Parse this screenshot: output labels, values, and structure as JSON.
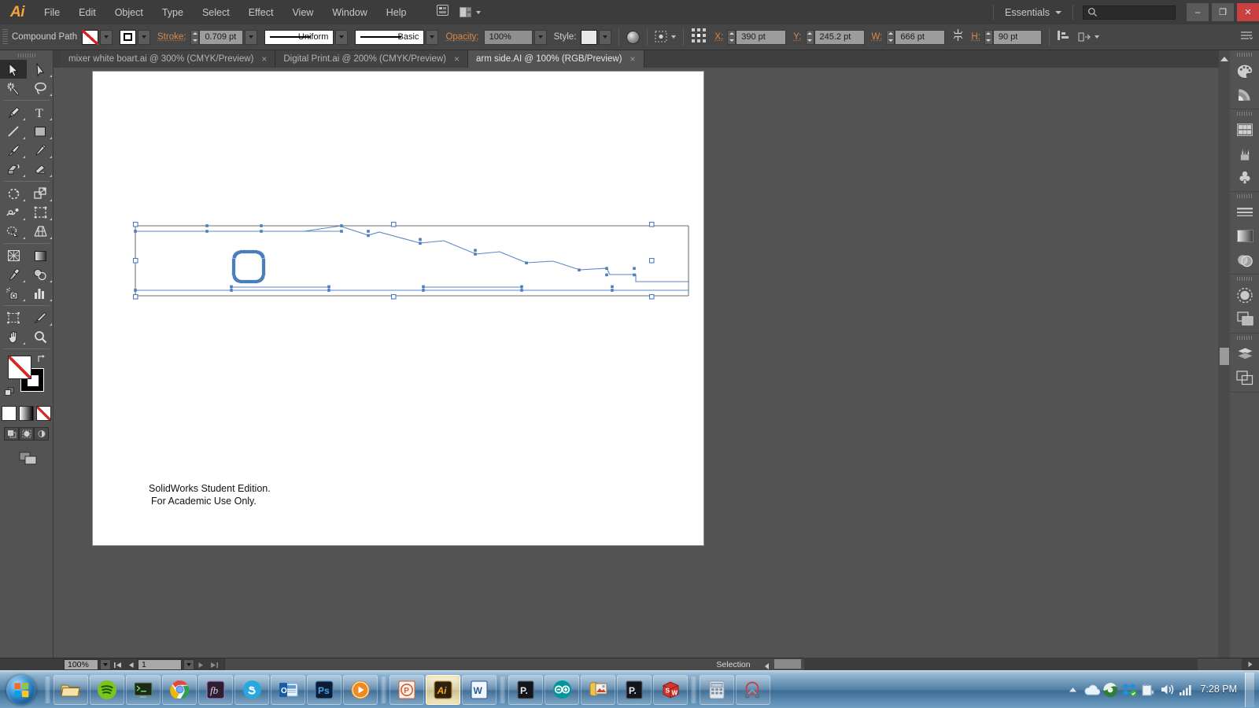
{
  "app": {
    "name": "Adobe Illustrator",
    "logo_text": "Ai"
  },
  "menubar": {
    "items": [
      {
        "label": "File"
      },
      {
        "label": "Edit"
      },
      {
        "label": "Object"
      },
      {
        "label": "Type"
      },
      {
        "label": "Select"
      },
      {
        "label": "Effect"
      },
      {
        "label": "View"
      },
      {
        "label": "Window"
      },
      {
        "label": "Help"
      }
    ],
    "workspace": "Essentials",
    "search_value": "",
    "search_placeholder": "",
    "window_controls": {
      "minimize": "–",
      "restore": "❐",
      "close": "✕"
    }
  },
  "controlbar": {
    "selection_type": "Compound Path",
    "fill_swatch": "none",
    "stroke_swatch": "black",
    "stroke_label": "Stroke:",
    "stroke_weight": "0.709 pt",
    "stroke_profile": "Uniform",
    "brush_definition": "Basic",
    "opacity_label": "Opacity:",
    "opacity_value": "100%",
    "style_label": "Style:",
    "x_label": "X:",
    "x_value": "390 pt",
    "y_label": "Y:",
    "y_value": "245.2 pt",
    "w_label": "W:",
    "w_value": "666 pt",
    "h_label": "H:",
    "h_value": "90 pt"
  },
  "tabs": [
    {
      "title": "mixer white boart.ai @ 300% (CMYK/Preview)",
      "close": "×",
      "active": false
    },
    {
      "title": "Digital Print.ai @ 200% (CMYK/Preview)",
      "close": "×",
      "active": false
    },
    {
      "title": "arm side.AI @ 100% (RGB/Preview)",
      "close": "×",
      "active": true
    }
  ],
  "toolbar": {
    "tools": [
      {
        "name": "selection-tool",
        "selected": true
      },
      {
        "name": "direct-selection-tool",
        "selected": false
      },
      {
        "name": "magic-wand-tool",
        "selected": false
      },
      {
        "name": "lasso-tool",
        "selected": false
      },
      {
        "name": "pen-tool",
        "selected": false
      },
      {
        "name": "type-tool",
        "selected": false
      },
      {
        "name": "line-segment-tool",
        "selected": false
      },
      {
        "name": "rectangle-tool",
        "selected": false
      },
      {
        "name": "paintbrush-tool",
        "selected": false
      },
      {
        "name": "pencil-tool",
        "selected": false
      },
      {
        "name": "blob-brush-tool",
        "selected": false
      },
      {
        "name": "eraser-tool",
        "selected": false
      },
      {
        "name": "rotate-tool",
        "selected": false
      },
      {
        "name": "scale-tool",
        "selected": false
      },
      {
        "name": "width-tool",
        "selected": false
      },
      {
        "name": "free-transform-tool",
        "selected": false
      },
      {
        "name": "shape-builder-tool",
        "selected": false
      },
      {
        "name": "perspective-grid-tool",
        "selected": false
      },
      {
        "name": "mesh-tool",
        "selected": false
      },
      {
        "name": "gradient-tool",
        "selected": false
      },
      {
        "name": "eyedropper-tool",
        "selected": false
      },
      {
        "name": "blend-tool",
        "selected": false
      },
      {
        "name": "symbol-sprayer-tool",
        "selected": false
      },
      {
        "name": "column-graph-tool",
        "selected": false
      },
      {
        "name": "artboard-tool",
        "selected": false
      },
      {
        "name": "slice-tool",
        "selected": false
      },
      {
        "name": "hand-tool",
        "selected": false
      },
      {
        "name": "zoom-tool",
        "selected": false
      }
    ],
    "fill_color": "#ffffff",
    "fill_is_none": true,
    "stroke_color": "#000000",
    "modes": [
      "color",
      "gradient",
      "none"
    ]
  },
  "right_dock": {
    "groups": [
      {
        "icons": [
          "color-panel-icon",
          "color-guide-icon"
        ]
      },
      {
        "icons": [
          "swatches-panel-icon",
          "brushes-panel-icon",
          "symbols-panel-icon"
        ]
      },
      {
        "icons": [
          "stroke-panel-icon",
          "gradient-panel-icon",
          "transparency-panel-icon"
        ]
      },
      {
        "icons": [
          "appearance-panel-icon",
          "graphic-styles-panel-icon"
        ]
      },
      {
        "icons": [
          "layers-panel-icon",
          "artboards-panel-icon"
        ]
      }
    ]
  },
  "artboard": {
    "text_line1": "SolidWorks Student Edition.",
    "text_line2": "For Academic Use Only."
  },
  "statusbar": {
    "zoom_value": "100%",
    "page_value": "1",
    "status_text": "Selection",
    "nav_first": "⏮",
    "nav_prev": "◀",
    "nav_next": "▶",
    "nav_last": "⏭"
  },
  "taskbar": {
    "start_label": "Start",
    "buttons": [
      {
        "name": "taskbar-windows-explorer",
        "label": "Windows Explorer"
      },
      {
        "name": "taskbar-spotify",
        "label": "Spotify"
      },
      {
        "name": "taskbar-terminal",
        "label": "Terminal"
      },
      {
        "name": "taskbar-google-chrome",
        "label": "Google Chrome"
      },
      {
        "name": "taskbar-fb-app",
        "label": "fb"
      },
      {
        "name": "taskbar-skype",
        "label": "Skype"
      },
      {
        "name": "taskbar-outlook",
        "label": "Microsoft Outlook"
      },
      {
        "name": "taskbar-photoshop",
        "label": "Adobe Photoshop"
      },
      {
        "name": "taskbar-vlc",
        "label": "VLC Media Player"
      },
      {
        "name": "taskbar-powerpoint-1",
        "label": "Microsoft PowerPoint"
      },
      {
        "name": "taskbar-illustrator",
        "label": "Adobe Illustrator",
        "active": true
      },
      {
        "name": "taskbar-word",
        "label": "Microsoft Word"
      },
      {
        "name": "taskbar-pdf-app-1",
        "label": "PDF"
      },
      {
        "name": "taskbar-arduino",
        "label": "Arduino"
      },
      {
        "name": "taskbar-image-viewer",
        "label": "Image Viewer"
      },
      {
        "name": "taskbar-pdf-app-2",
        "label": "PDF"
      },
      {
        "name": "taskbar-solidworks",
        "label": "SolidWorks"
      },
      {
        "name": "taskbar-calculator",
        "label": "Calculator"
      },
      {
        "name": "taskbar-snipping-tool",
        "label": "Snipping Tool"
      }
    ],
    "tray": [
      {
        "name": "show-hidden-icons-icon"
      },
      {
        "name": "onedrive-icon"
      },
      {
        "name": "browser-globe-icon"
      },
      {
        "name": "dropbox-icon"
      },
      {
        "name": "safely-remove-hardware-icon"
      },
      {
        "name": "volume-icon"
      },
      {
        "name": "network-signal-icon"
      }
    ],
    "clock": "7:28 PM"
  },
  "artwork": {
    "type": "compound-path-selection",
    "selection_color": "#4a7ebb",
    "description": "Selected vector compound path of an arm side profile with a rounded-square hole"
  },
  "colors": {
    "chrome_bg": "#535353",
    "menu_bg": "#3c3c3c",
    "panel_bg": "#464646",
    "accent_orange": "#d8894a",
    "selection_blue": "#4a7ebb",
    "close_red": "#c94040"
  }
}
